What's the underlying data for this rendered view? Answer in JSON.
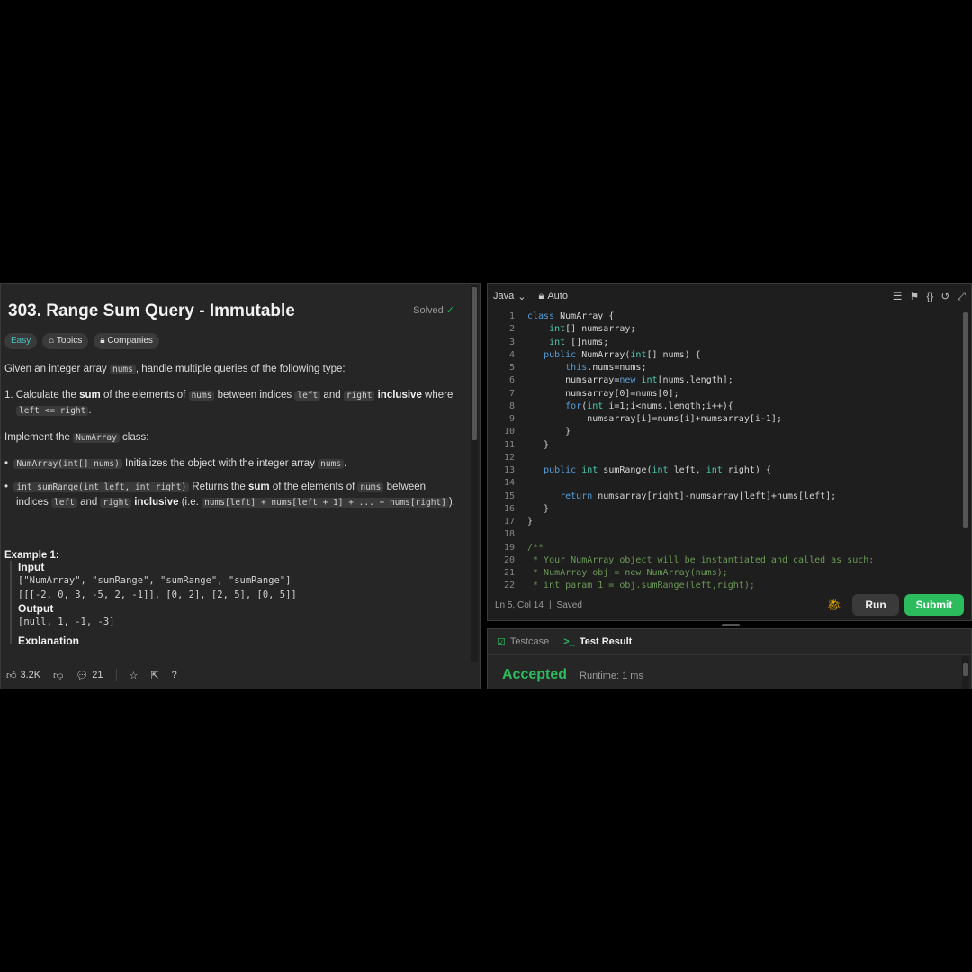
{
  "problem": {
    "title": "303. Range Sum Query - Immutable",
    "status": "Solved",
    "tags": [
      "Easy",
      "Topics",
      "Companies"
    ],
    "intro_a": "Given an integer array ",
    "intro_code": "nums",
    "intro_b": ", handle multiple queries of the following type:",
    "item1_a": "1. Calculate the ",
    "item1_b": "sum",
    "item1_c": " of the elements of ",
    "item1_d": "nums",
    "item1_e": " between indices ",
    "item1_f": "left",
    "item1_g": " and ",
    "item1_h": "right",
    "item1_i": " inclusive",
    "item1_j": " where",
    "item1_k": "left <= right",
    "item1_l": ".",
    "impl_a": "Implement the ",
    "impl_code": "NumArray",
    "impl_b": " class:",
    "b1_code": "NumArray(int[] nums)",
    "b1_text": " Initializes the object with the integer array ",
    "b1_code2": "nums",
    "b1_end": ".",
    "b2_code": "int sumRange(int left, int right)",
    "b2_a": " Returns the ",
    "b2_b": "sum",
    "b2_c": " of the elements of ",
    "b2_code2": "nums",
    "b2_d": " between",
    "b2_e": "indices ",
    "b2_f": "left",
    "b2_g": " and ",
    "b2_h": "right",
    "b2_i": " inclusive",
    "b2_j": " (i.e. ",
    "b2_k": "nums[left] + nums[left + 1] + ... + nums[right]",
    "b2_l": ").",
    "example_title": "Example 1:",
    "input_label": "Input",
    "input_line1": "[\"NumArray\", \"sumRange\", \"sumRange\", \"sumRange\"]",
    "input_line2": "[[[-2, 0, 3, -5, 2, -1]], [0, 2], [2, 5], [0, 5]]",
    "output_label": "Output",
    "output_line": "[null, 1, -1, -3]",
    "explanation_label": "Explanation"
  },
  "footer": {
    "likes": "3.2K",
    "comments": "21"
  },
  "editor": {
    "language": "Java",
    "mode": "Auto",
    "cursor": "Ln 5, Col 14",
    "saved": "Saved",
    "run_label": "Run",
    "submit_label": "Submit",
    "lines": [
      "class NumArray {",
      "    int[] numsarray;",
      "    int []nums;",
      "   public NumArray(int[] nums) {",
      "       this.nums=nums;",
      "       numsarray=new int[nums.length];",
      "       numsarray[0]=nums[0];",
      "       for(int i=1;i<nums.length;i++){",
      "           numsarray[i]=nums[i]+numsarray[i-1];",
      "       }",
      "   }",
      "",
      "   public int sumRange(int left, int right) {",
      "",
      "      return numsarray[right]-numsarray[left]+nums[left];",
      "   }",
      "}",
      "",
      "/**",
      " * Your NumArray object will be instantiated and called as such:",
      " * NumArray obj = new NumArray(nums);",
      " * int param_1 = obj.sumRange(left,right);"
    ]
  },
  "result": {
    "tab_testcase": "Testcase",
    "tab_result": "Test Result",
    "verdict": "Accepted",
    "runtime": "Runtime: 1 ms"
  },
  "colors": {
    "accent_green": "#2cbb5d",
    "easy": "#46c6c2"
  }
}
